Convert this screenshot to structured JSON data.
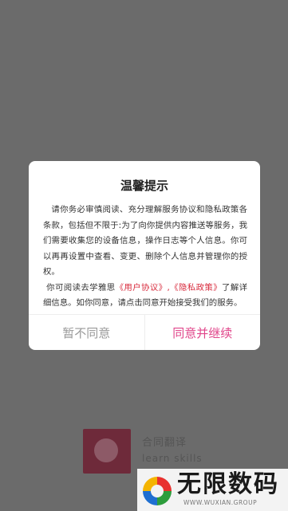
{
  "background": {
    "brand_name": "合同翻译",
    "brand_sub": "learn skills"
  },
  "dialog": {
    "title": "温馨提示",
    "paragraph1": "请你务必审慎阅读、充分理解服务协议和隐私政策各条款，包括但不限于:为了向你提供内容推送等服务，我们需要收集您的设备信息，操作日志等个人信息。你可以再再设置中查看、变更、删除个人信息并管理你的授权。",
    "paragraph2_prefix": "你可阅读去学雅思",
    "user_agreement_link": "《用户协议》",
    "separator": ",",
    "privacy_policy_link": "《隐私政策》",
    "paragraph2_suffix": "了解详细信息。如你同意，请点击同意开始接受我们的服务。",
    "disagree_label": "暂不同意",
    "agree_label": "同意并继续"
  },
  "watermark": {
    "text": "无限数码",
    "url": "WWW.WUXIAN.GROUP"
  },
  "colors": {
    "overlay_bg": "#6b6b6b",
    "link_red": "#d82a3c",
    "agree_pink": "#e0458a",
    "disagree_gray": "#999999"
  }
}
